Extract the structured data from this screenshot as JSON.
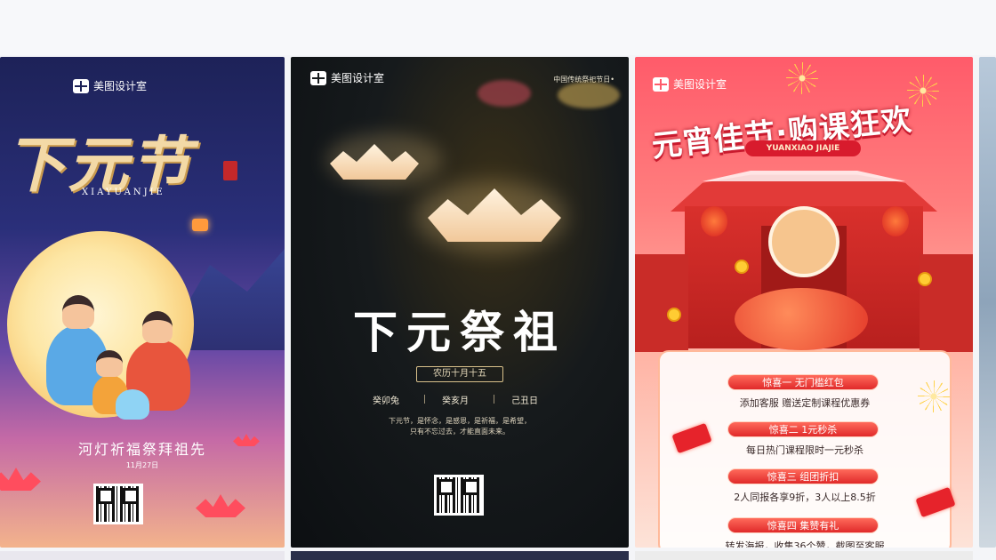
{
  "cards": [
    {
      "brand": "美图设计室",
      "title": "下元节",
      "subtitle": "XIAYUANJIE",
      "caption": "河灯祈福祭拜祖先",
      "date": "11月27日",
      "colors": {
        "top": "#1d2258",
        "bottom": "#f3b38c"
      }
    },
    {
      "brand": "美图设计室",
      "tag": "中国传统祭祀节日•",
      "title": "下元祭祖",
      "lunar": "农历十月十五",
      "ganzhi": [
        "癸卯兔",
        "癸亥月",
        "己丑日"
      ],
      "verse_lines": [
        "下元节，是怀念，是感恩，是祈福，是希望，",
        "只有不忘过去，才能直面未来。"
      ],
      "colors": {
        "background": "#0c0f12"
      }
    },
    {
      "brand": "美图设计室",
      "title": "元宵佳节·购课狂欢",
      "pill": "YUANXIAO JIAJIE",
      "offers": [
        {
          "tag": "惊喜一 无门槛红包",
          "desc": "添加客服 赠送定制课程优惠券"
        },
        {
          "tag": "惊喜二 1元秒杀",
          "desc": "每日热门课程限时一元秒杀"
        },
        {
          "tag": "惊喜三 组团折扣",
          "desc": "2人同报各享9折，3人以上8.5折"
        },
        {
          "tag": "惊喜四 集赞有礼",
          "desc": "转发海报，收集36个赞，截图至客服"
        }
      ],
      "colors": {
        "top": "#ff5b6a",
        "accent": "#e02a2a"
      }
    }
  ],
  "icons": [
    "meitu-logo-icon",
    "qr-code-icon",
    "lantern-icon",
    "lotus-icon",
    "firework-icon",
    "red-envelope-icon",
    "coin-icon"
  ]
}
